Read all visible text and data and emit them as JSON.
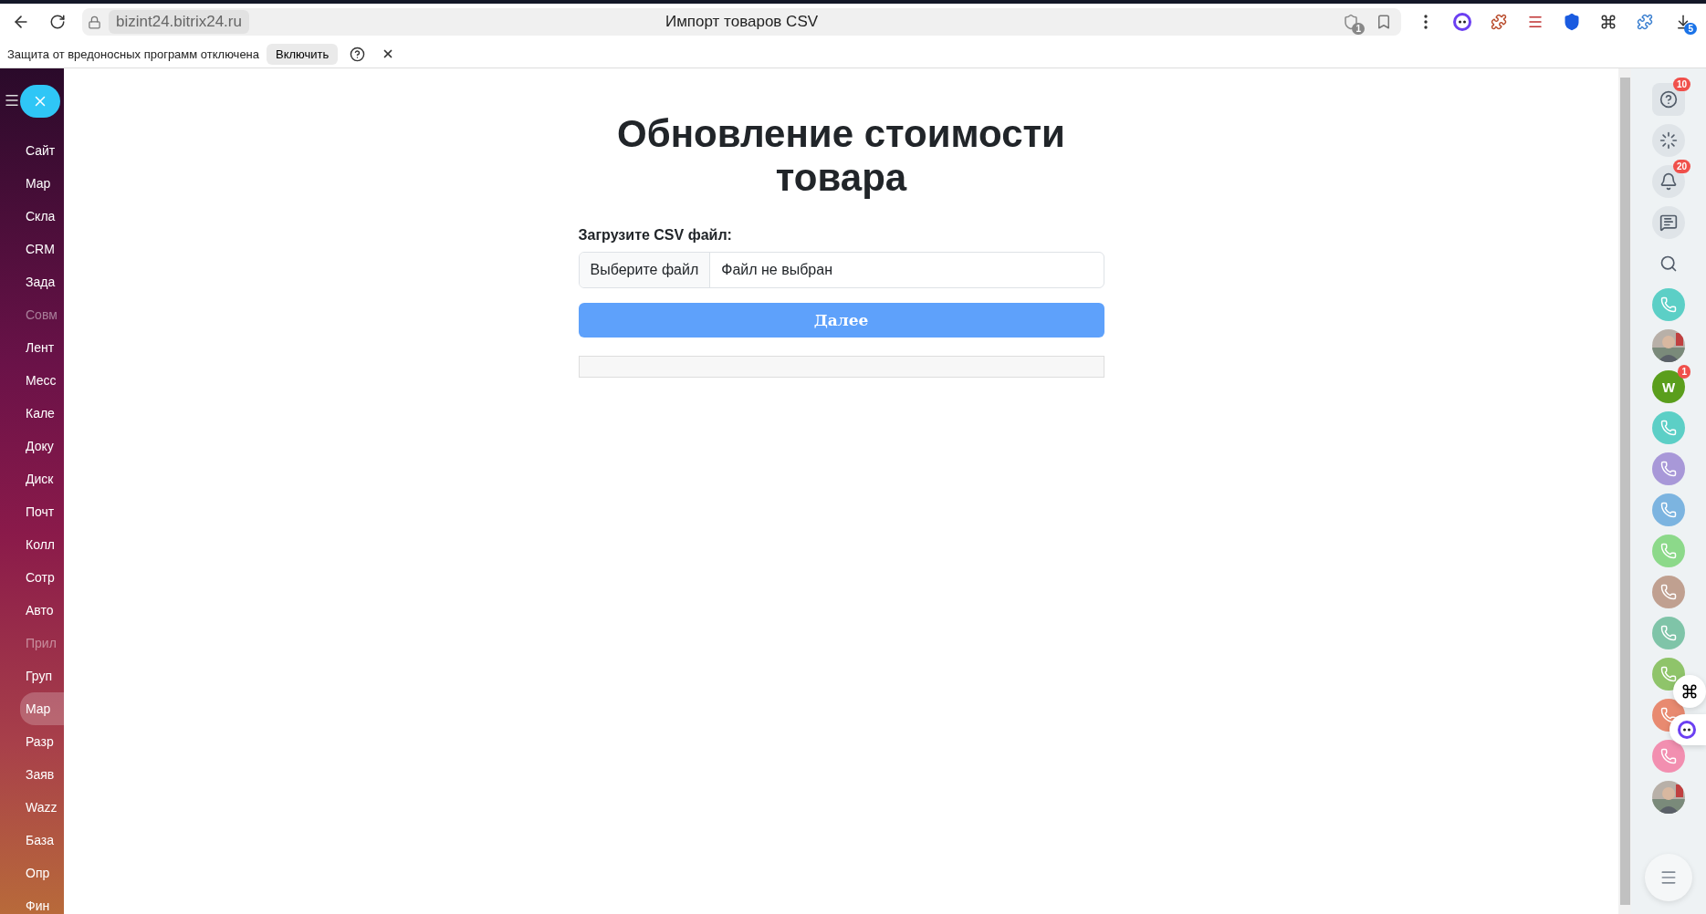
{
  "browser": {
    "url": "bizint24.bitrix24.ru",
    "title": "Импорт товаров CSV",
    "shield_badge": "1",
    "download_badge": "5"
  },
  "warning_bar": {
    "text": "Защита от вредоносных программ отключена",
    "button": "Включить"
  },
  "sidebar": {
    "items": [
      {
        "label": "Сайт",
        "kind": "item",
        "selected": false
      },
      {
        "label": "Мар",
        "kind": "item",
        "selected": false
      },
      {
        "label": "Скла",
        "kind": "item",
        "selected": false
      },
      {
        "label": "CRM",
        "kind": "item",
        "selected": false
      },
      {
        "label": "Зада",
        "kind": "item",
        "selected": false
      },
      {
        "label": "Совм",
        "kind": "header",
        "selected": false
      },
      {
        "label": "Лент",
        "kind": "item",
        "selected": false
      },
      {
        "label": "Месс",
        "kind": "item",
        "selected": false
      },
      {
        "label": "Кале",
        "kind": "item",
        "selected": false
      },
      {
        "label": "Доку",
        "kind": "item",
        "selected": false
      },
      {
        "label": "Диск",
        "kind": "item",
        "selected": false
      },
      {
        "label": "Почт",
        "kind": "item",
        "selected": false
      },
      {
        "label": "Колл",
        "kind": "item",
        "selected": false
      },
      {
        "label": "Сотр",
        "kind": "item",
        "selected": false
      },
      {
        "label": "Авто",
        "kind": "item",
        "selected": false
      },
      {
        "label": "Прил",
        "kind": "header",
        "selected": false
      },
      {
        "label": "Груп",
        "kind": "item",
        "selected": false
      },
      {
        "label": "Мар",
        "kind": "item",
        "selected": true
      },
      {
        "label": "Разр",
        "kind": "item",
        "selected": false
      },
      {
        "label": "Заяв",
        "kind": "item",
        "selected": false
      },
      {
        "label": "Wazz",
        "kind": "item",
        "selected": false
      },
      {
        "label": "База",
        "kind": "item",
        "selected": false
      },
      {
        "label": "Опр",
        "kind": "item",
        "selected": false
      },
      {
        "label": "Фин",
        "kind": "item",
        "selected": false
      }
    ]
  },
  "form": {
    "title": "Обновление стоимости товара",
    "label": "Загрузите CSV файл:",
    "file_button": "Выберите файл",
    "file_status": "Файл не выбран",
    "submit": "Далее",
    "progress": {
      "level": 0
    }
  },
  "right_panel": {
    "items": [
      {
        "kind": "help",
        "badge": "10"
      },
      {
        "kind": "copilot"
      },
      {
        "kind": "bell",
        "badge": "20"
      },
      {
        "kind": "chat"
      },
      {
        "kind": "search"
      },
      {
        "kind": "call",
        "color": "#5ccfc6"
      },
      {
        "kind": "avatar"
      },
      {
        "kind": "letter",
        "letter": "W",
        "color": "#5a9e1c",
        "badge": "1"
      },
      {
        "kind": "call",
        "color": "#5ccfc6"
      },
      {
        "kind": "call",
        "color": "#a898d8"
      },
      {
        "kind": "call",
        "color": "#7cb4e0"
      },
      {
        "kind": "call",
        "color": "#8cd98a"
      },
      {
        "kind": "call",
        "color": "#c0a090"
      },
      {
        "kind": "call",
        "color": "#7fc4a8"
      },
      {
        "kind": "call",
        "color": "#8fc46a"
      },
      {
        "kind": "call",
        "color": "#e88a70"
      },
      {
        "kind": "call",
        "color": "#f28fb0"
      },
      {
        "kind": "avatar"
      }
    ]
  }
}
